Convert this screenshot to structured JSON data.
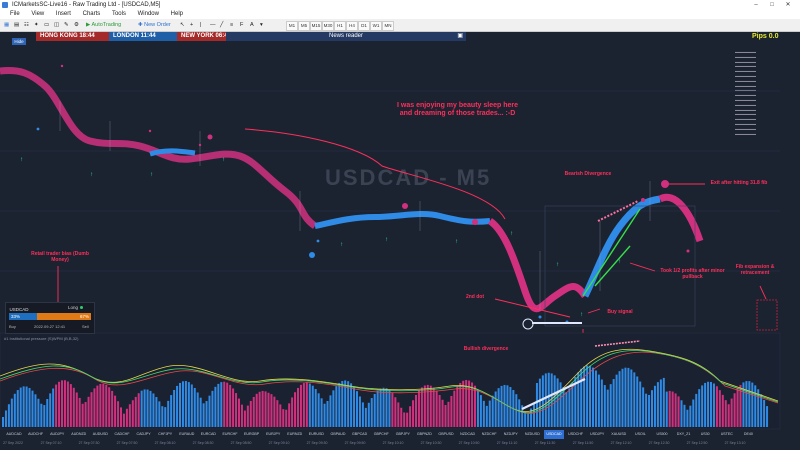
{
  "window": {
    "title": "ICMarketsSC-Live16 - Raw Trading Ltd - [USDCAD,M5]"
  },
  "menu": [
    "File",
    "View",
    "Insert",
    "Charts",
    "Tools",
    "Window",
    "Help"
  ],
  "toolbar": {
    "autotrading": "AutoTrading",
    "new_order": "New Order",
    "timeframes": [
      "M1",
      "M5",
      "M15",
      "M30",
      "H1",
      "H4",
      "D1",
      "W1",
      "MN"
    ]
  },
  "sessions": {
    "hong_kong": "HONG KONG 18:44",
    "london": "LONDON 11:44",
    "new_york": "NEW YORK 06:44"
  },
  "news_reader": "News reader",
  "hide_label": "Hide",
  "pips": "Pips 0.0",
  "watermark": "USDCAD - M5",
  "annotations": {
    "sleep": "I was enjoying my beauty sleep here and dreaming of those trades... :-D",
    "bearish_div": "Bearish Divergence",
    "exit": "Exit after hitting 31.8 fib",
    "took_profits": "Took 1/2 profits after minor pullback",
    "fib": "Fib expansion & retracement",
    "retail": "Retail trader bias (Dumb Money)",
    "second_dot": "2nd dot",
    "buy_signal": "Buy signal",
    "bullish_div": "Bullish divergence"
  },
  "trade_panel": {
    "symbol": "USDCAD",
    "direction": "Long",
    "buy_pct": "33%",
    "sell_pct": "67%",
    "buy_label": "Buy",
    "sell_label": "Sell",
    "timestamp": "2022.09.27 12:41"
  },
  "indicator_label": "#1 Institutional pressure (S)WPM (B,B,32)",
  "symbols": [
    "AUDCAD",
    "AUDCHF",
    "AUDJPY",
    "AUDNZD",
    "AUDUSD",
    "CADCHF",
    "CADJPY",
    "CHFJPY",
    "EURAUD",
    "EURCAD",
    "EURCHF",
    "EURGBP",
    "EURJPY",
    "EURNZD",
    "EURUSD",
    "GBPAUD",
    "GBPCAD",
    "GBPCHF",
    "GBPJPY",
    "GBPNZD",
    "GBPUSD",
    "NZDCAD",
    "NZDCHF",
    "NZDJPY",
    "NZDUSD",
    "USDCAD",
    "USDCHF",
    "USDJPY",
    "XAUUSD",
    "USOIL",
    "US500",
    "DXY_Z1",
    "US30",
    "USTEC",
    "DE40"
  ],
  "active_symbol": "USDCAD",
  "dates": [
    "27 Sep 2022",
    "27 Sep 07:10",
    "27 Sep 07:30",
    "27 Sep 07:50",
    "27 Sep 08:10",
    "27 Sep 08:30",
    "27 Sep 08:50",
    "27 Sep 09:10",
    "27 Sep 09:30",
    "27 Sep 09:50",
    "27 Sep 10:10",
    "27 Sep 10:30",
    "27 Sep 10:50",
    "27 Sep 11:10",
    "27 Sep 11:30",
    "27 Sep 11:50",
    "27 Sep 12:10",
    "27 Sep 12:30",
    "27 Sep 12:50",
    "27 Sep 13:10"
  ],
  "colors": {
    "bull": "#2f8be6",
    "bear": "#d1307f",
    "annotation": "#ff2f5a",
    "background": "#1b2331"
  }
}
